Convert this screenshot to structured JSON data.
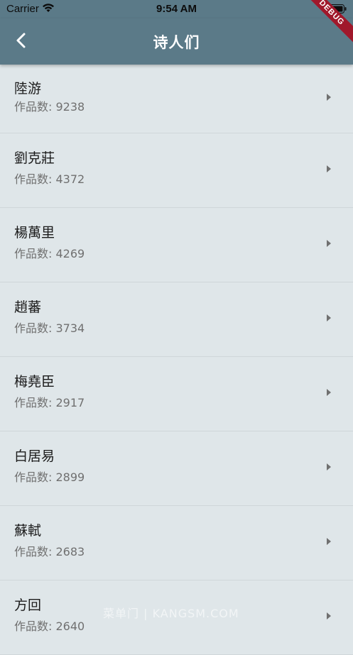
{
  "status_bar": {
    "carrier": "Carrier",
    "time": "9:54 AM"
  },
  "app_bar": {
    "title": "诗人们",
    "back_icon": "chevron-left-icon",
    "debug_banner": "DEBUG",
    "background": "#5b7a88"
  },
  "poets": [
    {
      "name": "陸游",
      "count": "作品数: 9238"
    },
    {
      "name": "劉克莊",
      "count": "作品数: 4372"
    },
    {
      "name": "楊萬里",
      "count": "作品数: 4269"
    },
    {
      "name": "趙蕃",
      "count": "作品数: 3734"
    },
    {
      "name": "梅堯臣",
      "count": "作品数: 2917"
    },
    {
      "name": "白居易",
      "count": "作品数: 2899"
    },
    {
      "name": "蘇軾",
      "count": "作品数: 2683"
    },
    {
      "name": "方回",
      "count": "作品数: 2640"
    }
  ],
  "watermark": "菜单门 | KANGSM.COM",
  "colors": {
    "background": "#dfe6e9",
    "divider": "#cfd6d9",
    "secondary_text": "#707070"
  }
}
